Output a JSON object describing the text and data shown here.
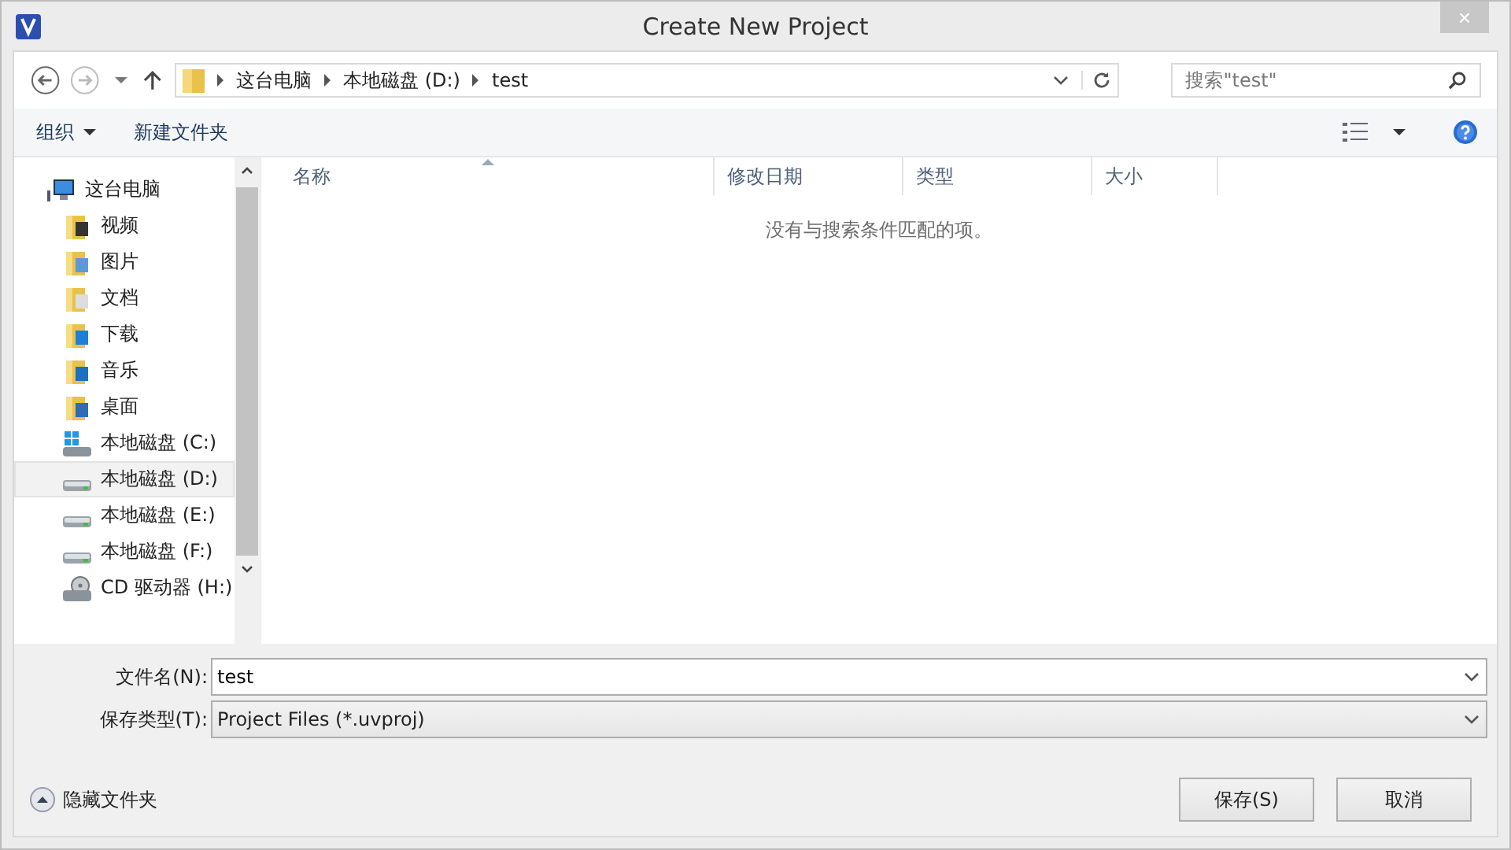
{
  "window": {
    "title": "Create New Project",
    "close": "×"
  },
  "address": {
    "crumbs": [
      "这台电脑",
      "本地磁盘 (D:)",
      "test"
    ],
    "search_placeholder": "搜索\"test\""
  },
  "toolbar": {
    "organize": "组织",
    "new_folder": "新建文件夹"
  },
  "sidebar": {
    "items": [
      {
        "label": "这台电脑",
        "kind": "computer",
        "selected": false,
        "children": [
          {
            "label": "视频",
            "kind": "folder-video",
            "selected": false
          },
          {
            "label": "图片",
            "kind": "folder-picture",
            "selected": false
          },
          {
            "label": "文档",
            "kind": "folder-document",
            "selected": false
          },
          {
            "label": "下载",
            "kind": "folder-download",
            "selected": false
          },
          {
            "label": "音乐",
            "kind": "folder-music",
            "selected": false
          },
          {
            "label": "桌面",
            "kind": "folder-desktop",
            "selected": false
          },
          {
            "label": "本地磁盘 (C:)",
            "kind": "drive-system",
            "selected": false
          },
          {
            "label": "本地磁盘 (D:)",
            "kind": "drive",
            "selected": true
          },
          {
            "label": "本地磁盘 (E:)",
            "kind": "drive",
            "selected": false
          },
          {
            "label": "本地磁盘 (F:)",
            "kind": "drive",
            "selected": false
          },
          {
            "label": "CD 驱动器 (H:)",
            "kind": "cd",
            "selected": false
          }
        ]
      }
    ]
  },
  "table": {
    "columns": [
      "名称",
      "修改日期",
      "类型",
      "大小"
    ],
    "empty_message": "没有与搜索条件匹配的项。"
  },
  "form": {
    "file_name_label": "文件名(N):",
    "file_name": "test",
    "file_type_label": "保存类型(T):",
    "file_type": "Project Files (*.uvproj)"
  },
  "hide_folders": "隐藏文件夹",
  "buttons": [
    "保存(S)",
    "取消"
  ]
}
